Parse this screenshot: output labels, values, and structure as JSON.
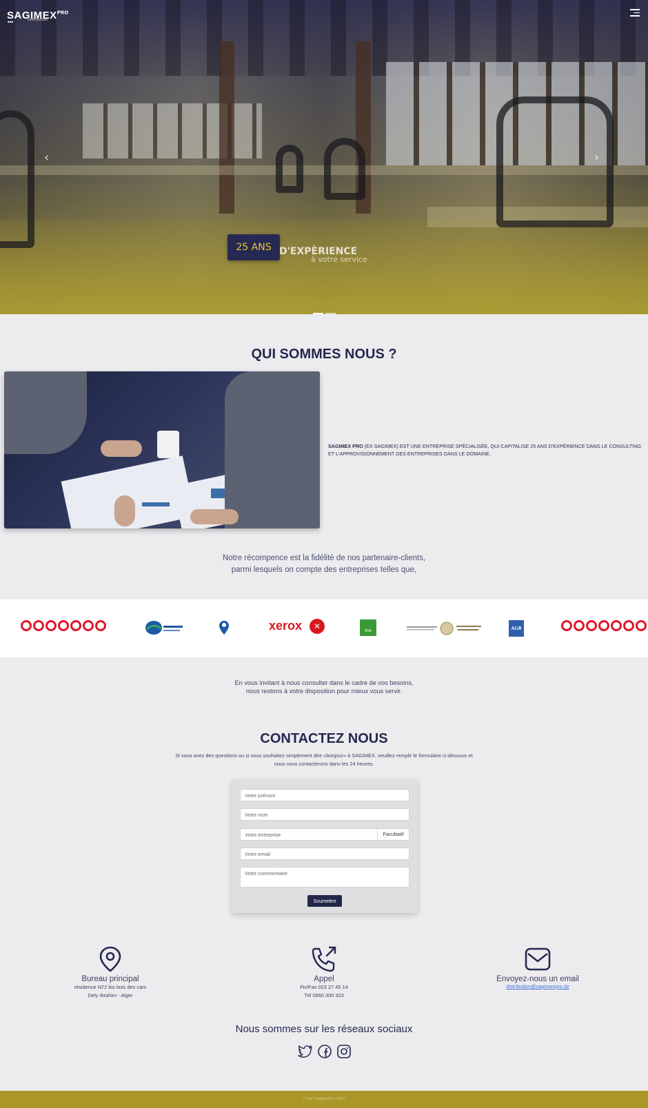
{
  "header": {
    "brand": "SAGIMEX",
    "brand_suffix": "PRO",
    "brand_sub": "Distribution",
    "menu_icon": "hamburger-icon"
  },
  "hero": {
    "badge": "25 ANS",
    "headline": "D'EXPÈRIENCE",
    "subline": "à votre service",
    "prev_icon": "chevron-left-icon",
    "next_icon": "chevron-right-icon"
  },
  "about": {
    "title": "QUI SOMMES NOUS ?",
    "company": "SAGIMEX PRO",
    "text": " (ex SAGIMEX) EST UNE ENTREPRISE SPÉCIALISÉE, QUI CAPITALISE 25 ANS D'EXPÉRIENCE DANS LE CONSULTING ET L'APPROVISIONNEMENT DES ENTREPRISES DANS LE DOMAINE.",
    "reward_line1": "Notre récompence est la fidélité de nos partenaire-clients,",
    "reward_line2": "parmi lesquels on compte des entreprises telles que,"
  },
  "partners": {
    "xerox": "xerox",
    "agb": "AGB",
    "sna": "SNA"
  },
  "invite": {
    "line1": "En vous invitant à nous consulter dans le cadre de vos besoins,",
    "line2": "nous restons à votre disposition pour mieux vous servir."
  },
  "contact": {
    "title": "CONTACTEZ NOUS",
    "sub_line1": "Si vous avez des questions ou si vous souhaitez simplement dire «bonjour» à SAGIMEX, veuillez remplir le formulaire ci-dessous et",
    "sub_line2": "nous vous contacterons dans les 24 heures.",
    "firstname_placeholder": "Votre prénom",
    "lastname_placeholder": "Votre nom",
    "company_placeholder": "Votre entreprise",
    "company_addon": "Facultatif",
    "email_placeholder": "Votre email",
    "comment_placeholder": "Votre commentaire",
    "submit_label": "Soumettre"
  },
  "info": {
    "office_title": "Bureau principal",
    "office_line1": "résidence N72 bis bois des cars",
    "office_line2": "Dely Ibrahim - Alger",
    "call_title": "Appel",
    "call_line1": "Fix/Fax 023 27 45 14",
    "call_line2": "Tél 0660 300 323",
    "email_title": "Envoyez-nous un email",
    "email": "distribution@sagimexpro.dz"
  },
  "social": {
    "title": "Nous sommes sur les réseaux sociaux",
    "icons": [
      "twitter-icon",
      "facebook-icon",
      "instagram-icon"
    ]
  },
  "footer": {
    "text": "© Sarl SagimexPro 2023"
  },
  "colors": {
    "navy": "#24284f",
    "gold": "#ab9728",
    "badge_text": "#e6c32e",
    "ooredoo_red": "#e0172b"
  }
}
